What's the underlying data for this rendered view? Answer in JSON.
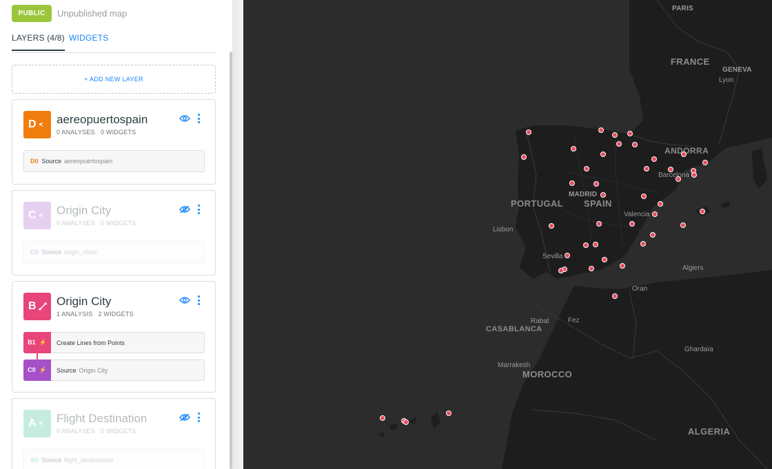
{
  "header": {
    "visibility_badge": "PUBLIC",
    "publish_status": "Unpublished map"
  },
  "tabs": [
    {
      "label": "LAYERS (4/8)",
      "active": true
    },
    {
      "label": "WIDGETS",
      "active": false
    }
  ],
  "add_layer_label": "+ ADD NEW LAYER",
  "layers": [
    {
      "letter": "D",
      "color": "#f07e0f",
      "title": "aereopuertospain",
      "analyses": "0 ANALYSES",
      "widgets": "0 WIDGETS",
      "visible": true,
      "source": {
        "code": "D0",
        "label": "Source",
        "value": "aereopuertospain"
      }
    },
    {
      "letter": "C",
      "color": "#b87bd9",
      "title": "Origin City",
      "analyses": "0 ANALYSES",
      "widgets": "0 WIDGETS",
      "visible": false,
      "source": {
        "code": "C0",
        "label": "Source",
        "value": "origin_cities"
      }
    },
    {
      "letter": "B",
      "color": "#e8457a",
      "title": "Origin City",
      "analyses": "1 ANALYSIS",
      "widgets": "2 WIDGETS",
      "visible": true,
      "nodes": [
        {
          "code": "B1",
          "color": "#e8457a",
          "label": "Create Lines from Points",
          "value": ""
        },
        {
          "code": "C0",
          "color": "#a550c9",
          "label": "Source",
          "value": "Origin City"
        }
      ]
    },
    {
      "letter": "A",
      "color": "#5fc9a8",
      "title": "Flight Destination",
      "analyses": "0 ANALYSES",
      "widgets": "0 WIDGETS",
      "visible": false,
      "source": {
        "code": "A0",
        "label": "Source",
        "value": "flight_destinations"
      }
    }
  ],
  "map": {
    "labels": {
      "paris": "PARIS",
      "france": "FRANCE",
      "geneva": "GENEVA",
      "lyon": "Lyon",
      "andorra": "ANDORRA",
      "barcelona": "Barcelona",
      "portugal": "PORTUGAL",
      "madrid": "MADRID",
      "spain": "SPAIN",
      "lisbon": "Lisbon",
      "valencia": "Valencia",
      "sevilla": "Sevilla",
      "algiers": "Algiers",
      "oran": "Oran",
      "rabat": "Rabat",
      "fez": "Fez",
      "casablanca": "CASABLANCA",
      "marrakesh": "Marrakesh",
      "morocco": "MOROCCO",
      "ghardaia": "Ghardaïa",
      "algeria": "ALGERIA"
    },
    "point_color": "#e84a5f"
  }
}
